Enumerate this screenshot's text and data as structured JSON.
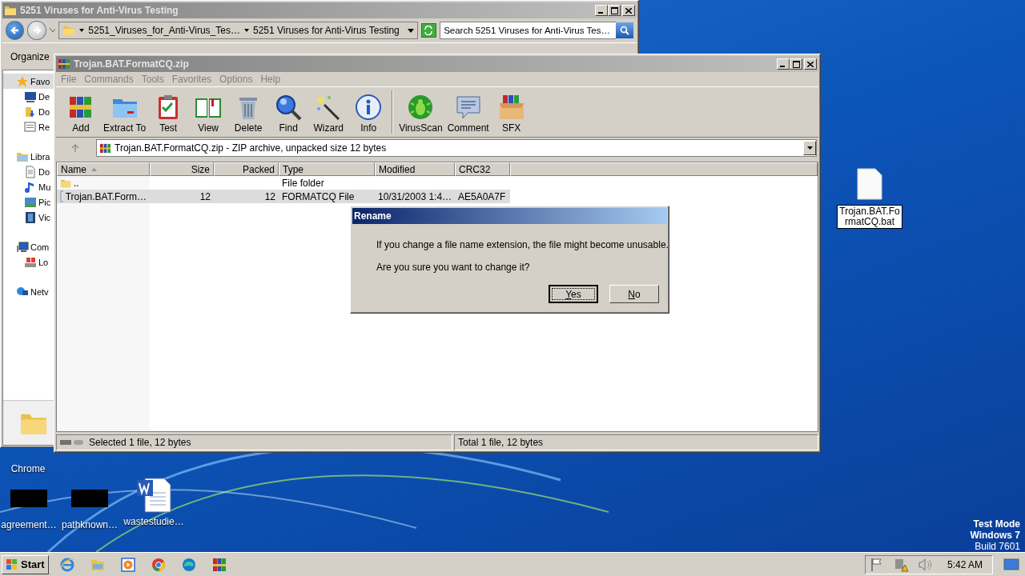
{
  "explorer": {
    "title": "5251 Viruses for Anti-Virus Testing",
    "crumbs": [
      "5251_Viruses_for_Anti-Virus_Tes…",
      "5251 Viruses for Anti-Virus Testing"
    ],
    "search": {
      "placeholder": "Search 5251 Viruses for Anti-Virus Tes…"
    },
    "commands": [
      "Organize"
    ],
    "nav": [
      {
        "label": "Favo",
        "kind": "star",
        "selected": true,
        "children": [
          {
            "label": "De",
            "kind": "desktop",
            "selected": false
          },
          {
            "label": "Do",
            "kind": "download",
            "selected": false
          },
          {
            "label": "Re",
            "kind": "recent",
            "selected": false
          }
        ]
      },
      {
        "label": "Libra",
        "kind": "library",
        "selected": false,
        "children": [
          {
            "label": "Do",
            "kind": "document",
            "selected": false
          },
          {
            "label": "Mu",
            "kind": "music",
            "selected": false
          },
          {
            "label": "Pic",
            "kind": "picture",
            "selected": false
          },
          {
            "label": "Vic",
            "kind": "video",
            "selected": false
          }
        ]
      },
      {
        "label": "Com",
        "kind": "computer",
        "selected": false,
        "children": [
          {
            "label": "Lo",
            "kind": "drive",
            "selected": false
          }
        ]
      },
      {
        "label": "Netv",
        "kind": "network",
        "selected": false
      }
    ]
  },
  "winrar": {
    "title": "Trojan.BAT.FormatCQ.zip",
    "menu": [
      {
        "label": "File",
        "disabled": true
      },
      {
        "label": "Commands",
        "disabled": true
      },
      {
        "label": "Tools",
        "disabled": true
      },
      {
        "label": "Favorites",
        "disabled": true
      },
      {
        "label": "Options",
        "disabled": true
      },
      {
        "label": "Help",
        "disabled": true
      }
    ],
    "toolbar_groups": [
      {
        "buttons": [
          {
            "label": "Add",
            "kind": "add"
          },
          {
            "label": "Extract To",
            "kind": "extract"
          },
          {
            "label": "Test",
            "kind": "test"
          },
          {
            "label": "View",
            "kind": "view"
          },
          {
            "label": "Delete",
            "kind": "delete"
          },
          {
            "label": "Find",
            "kind": "find"
          },
          {
            "label": "Wizard",
            "kind": "wizard"
          },
          {
            "label": "Info",
            "kind": "info"
          }
        ]
      },
      {
        "buttons": [
          {
            "label": "VirusScan",
            "kind": "virusscan"
          },
          {
            "label": "Comment",
            "kind": "comment"
          },
          {
            "label": "SFX",
            "kind": "sfx"
          }
        ]
      }
    ],
    "path": "Trojan.BAT.FormatCQ.zip - ZIP archive, unpacked size 12 bytes",
    "columns": [
      {
        "label": "Name",
        "sorted": true
      },
      {
        "label": "Size",
        "sorted": false
      },
      {
        "label": "Packed",
        "sorted": false
      },
      {
        "label": "Type",
        "sorted": false
      },
      {
        "label": "Modified",
        "sorted": false
      },
      {
        "label": "CRC32",
        "sorted": false
      }
    ],
    "rows": [
      {
        "kind": "folder",
        "selected": false,
        "cells": [
          "..",
          "",
          "",
          "File folder",
          "",
          ""
        ]
      },
      {
        "kind": "file",
        "selected": true,
        "cells": [
          "Trojan.BAT.Form…",
          "12",
          "12",
          "FORMATCQ File",
          "10/31/2003 1:4…",
          "AE5A0A7F"
        ]
      }
    ],
    "status": [
      "Selected 1 file, 12 bytes",
      "Total 1 file, 12 bytes"
    ]
  },
  "dialog": {
    "title": "Rename",
    "lines": [
      "If you change a file name extension, the file might become unusable.",
      "Are you sure you want to change it?"
    ],
    "buttons": [
      {
        "label": "Yes",
        "focused": true
      },
      {
        "label": "No",
        "focused": false
      }
    ]
  },
  "desktop_icons": [
    {
      "label": "Trojan.BAT.FormatCQ.bat",
      "kind": "blank",
      "selected": true
    },
    {
      "label": "Chrome",
      "kind": "covered",
      "selected": false
    },
    {
      "label": "agreement…",
      "kind": "redacted",
      "selected": false
    },
    {
      "label": "pathknown…",
      "kind": "redacted",
      "selected": false
    },
    {
      "label": "wastestudie…",
      "kind": "word",
      "selected": false
    }
  ],
  "system_notice": [
    "Test Mode",
    "Windows 7",
    "Build 7601"
  ],
  "taskbar": {
    "start": "Start",
    "apps": [
      {
        "kind": "ie"
      },
      {
        "kind": "explorer"
      },
      {
        "kind": "media"
      },
      {
        "kind": "chrome"
      },
      {
        "kind": "edge"
      },
      {
        "kind": "winrar"
      }
    ],
    "tray": [
      {
        "kind": "flag"
      },
      {
        "kind": "network"
      },
      {
        "kind": "volume"
      }
    ],
    "clock": "5:42 AM"
  }
}
